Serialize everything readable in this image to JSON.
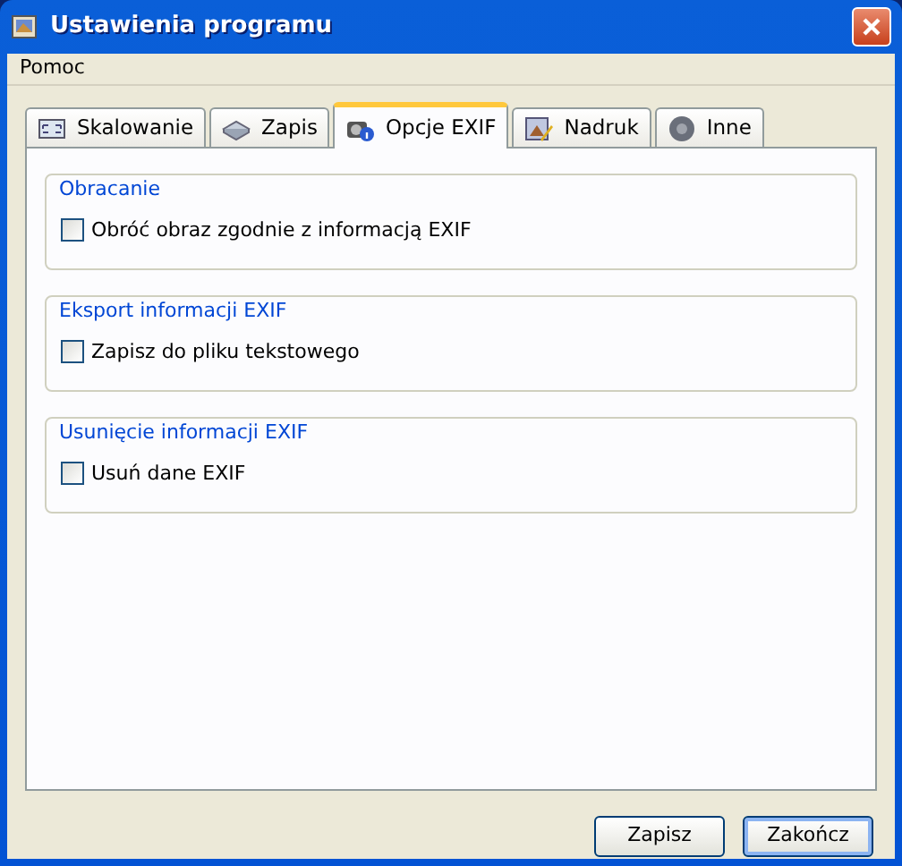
{
  "window": {
    "title": "Ustawienia programu"
  },
  "menu": [
    "Pomoc"
  ],
  "tabs": [
    {
      "label": "Skalowanie",
      "selected": false
    },
    {
      "label": "Zapis",
      "selected": false
    },
    {
      "label": "Opcje EXIF",
      "selected": true
    },
    {
      "label": "Nadruk",
      "selected": false
    },
    {
      "label": "Inne",
      "selected": false
    }
  ],
  "groups": [
    {
      "title": "Obracanie",
      "options": [
        {
          "label": "Obróć obraz zgodnie z informacją EXIF",
          "checked": false
        }
      ]
    },
    {
      "title": "Eksport informacji EXIF",
      "options": [
        {
          "label": "Zapisz do pliku tekstowego",
          "checked": false
        }
      ]
    },
    {
      "title": "Usunięcie informacji EXIF",
      "options": [
        {
          "label": "Usuń dane EXIF",
          "checked": false
        }
      ]
    }
  ],
  "buttons": [
    {
      "label": "Zapisz",
      "default": false
    },
    {
      "label": "Zakończ",
      "default": true
    }
  ]
}
